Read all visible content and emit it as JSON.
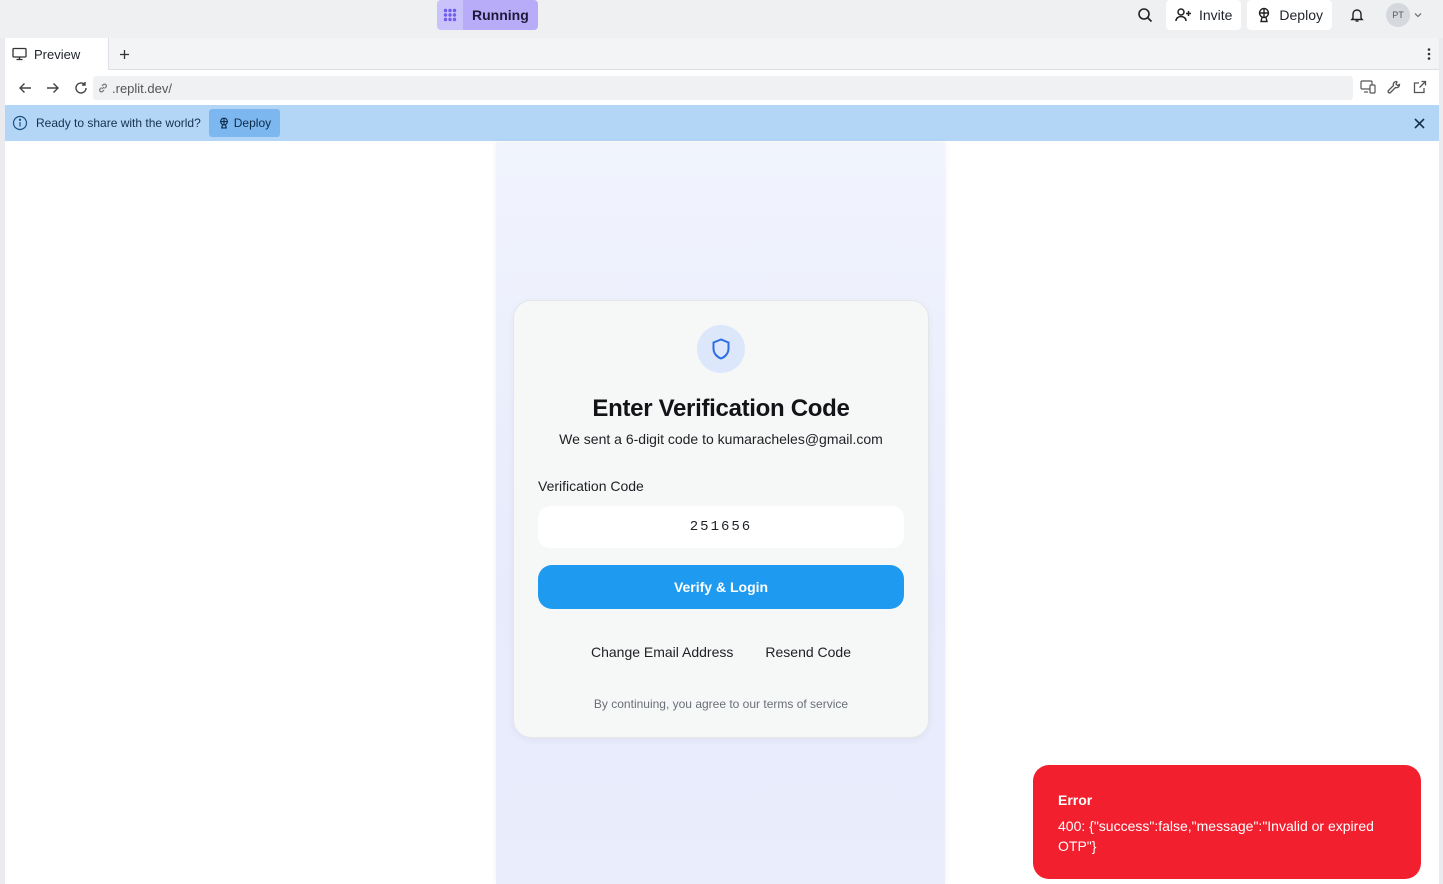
{
  "topbar": {
    "run_status": "Running",
    "invite_label": "Invite",
    "deploy_label": "Deploy",
    "avatar_initials": "PT"
  },
  "tabs": [
    {
      "label": "Preview"
    }
  ],
  "url": ".replit.dev/",
  "banner": {
    "message": "Ready to share with the world?",
    "deploy_label": "Deploy"
  },
  "card": {
    "title": "Enter Verification Code",
    "subtitle": "We sent a 6-digit code to kumaracheles@gmail.com",
    "code_label": "Verification Code",
    "code_value": "251656",
    "verify_label": "Verify & Login",
    "change_email_label": "Change Email Address",
    "resend_label": "Resend Code",
    "terms": "By continuing, you agree to our terms of service"
  },
  "toast": {
    "title": "Error",
    "message": "400: {\"success\":false,\"message\":\"Invalid or expired OTP\"}"
  },
  "colors": {
    "running_bg": "#b8acf8",
    "banner_bg": "#b3d6f7",
    "verify_button": "#1e9af0",
    "error_toast": "#f2202f"
  },
  "icons": [
    "apps-grid-icon",
    "search-icon",
    "user-plus-icon",
    "deploy-icon",
    "bell-icon",
    "chevron-down-icon",
    "monitor-icon",
    "plus-icon",
    "more-vertical-icon",
    "back-arrow-icon",
    "forward-arrow-icon",
    "reload-icon",
    "link-icon",
    "devices-icon",
    "wrench-icon",
    "external-link-icon",
    "info-icon",
    "close-icon",
    "shield-icon"
  ]
}
